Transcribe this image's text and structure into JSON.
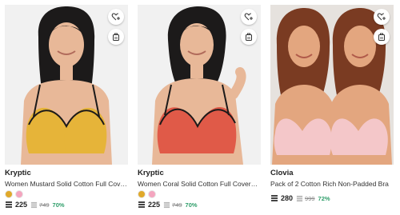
{
  "products": [
    {
      "brand": "Kryptic",
      "title": "Women Mustard Solid Cotton Full Coverage Bra",
      "swatches": [
        "#e0a92a",
        "#f4a5bf"
      ],
      "price": "225",
      "mrp": "749",
      "discount": "70%",
      "bg": "#f1f1f1",
      "bra_color": "#e6b439",
      "hair_color": "#1c1a1a",
      "skin_color": "#e8b898"
    },
    {
      "brand": "Kryptic",
      "title": "Women Coral Solid Cotton Full Coverage Bra",
      "swatches": [
        "#e0a92a",
        "#f4a5bf"
      ],
      "price": "225",
      "mrp": "749",
      "discount": "70%",
      "bg": "#f1f1f1",
      "bra_color": "#e05a48",
      "hair_color": "#1c1a1a",
      "skin_color": "#e8b898"
    },
    {
      "brand": "Clovia",
      "title": "Pack of 2 Cotton Rich Non-Padded Bra",
      "swatches": [],
      "price": "280",
      "mrp": "999",
      "discount": "72%",
      "bg": "#e6e2de",
      "bra_color": "#f4c7c9",
      "hair_color": "#7a3b22",
      "skin_color": "#e3a67f"
    }
  ],
  "icons": {
    "wishlist": "heart-plus-icon",
    "compare": "cart-bag-icon",
    "price": "stack-icon",
    "mrp": "stack-icon"
  }
}
